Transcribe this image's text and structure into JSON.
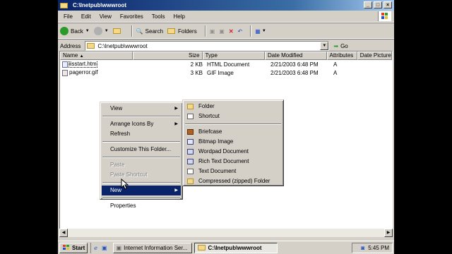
{
  "window": {
    "title": "C:\\Inetpub\\wwwroot"
  },
  "menubar": [
    "File",
    "Edit",
    "View",
    "Favorites",
    "Tools",
    "Help"
  ],
  "toolbar": {
    "back": "Back",
    "search": "Search",
    "folders": "Folders"
  },
  "address": {
    "label": "Address",
    "value": "C:\\Inetpub\\wwwroot",
    "go": "Go"
  },
  "columns": [
    "Name",
    "Size",
    "Type",
    "Date Modified",
    "Attributes",
    "Date Picture"
  ],
  "files": [
    {
      "name": "iisstart.htm",
      "size": "2 KB",
      "type": "HTML Document",
      "date": "2/21/2003 6:48 PM",
      "attr": "A"
    },
    {
      "name": "pagerror.gif",
      "size": "3 KB",
      "type": "GIF Image",
      "date": "2/21/2003 6:48 PM",
      "attr": "A"
    }
  ],
  "context_menu": {
    "view": "View",
    "arrange": "Arrange Icons By",
    "refresh": "Refresh",
    "customize": "Customize This Folder...",
    "paste": "Paste",
    "paste_shortcut": "Paste Shortcut",
    "new": "New",
    "properties": "Properties"
  },
  "new_submenu": [
    "Folder",
    "Shortcut",
    "Briefcase",
    "Bitmap Image",
    "Wordpad Document",
    "Rich Text Document",
    "Text Document",
    "Compressed (zipped) Folder"
  ],
  "taskbar": {
    "start": "Start",
    "tasks": [
      "Internet Information Ser...",
      "C:\\Inetpub\\wwwroot"
    ],
    "clock": "5:45 PM"
  }
}
